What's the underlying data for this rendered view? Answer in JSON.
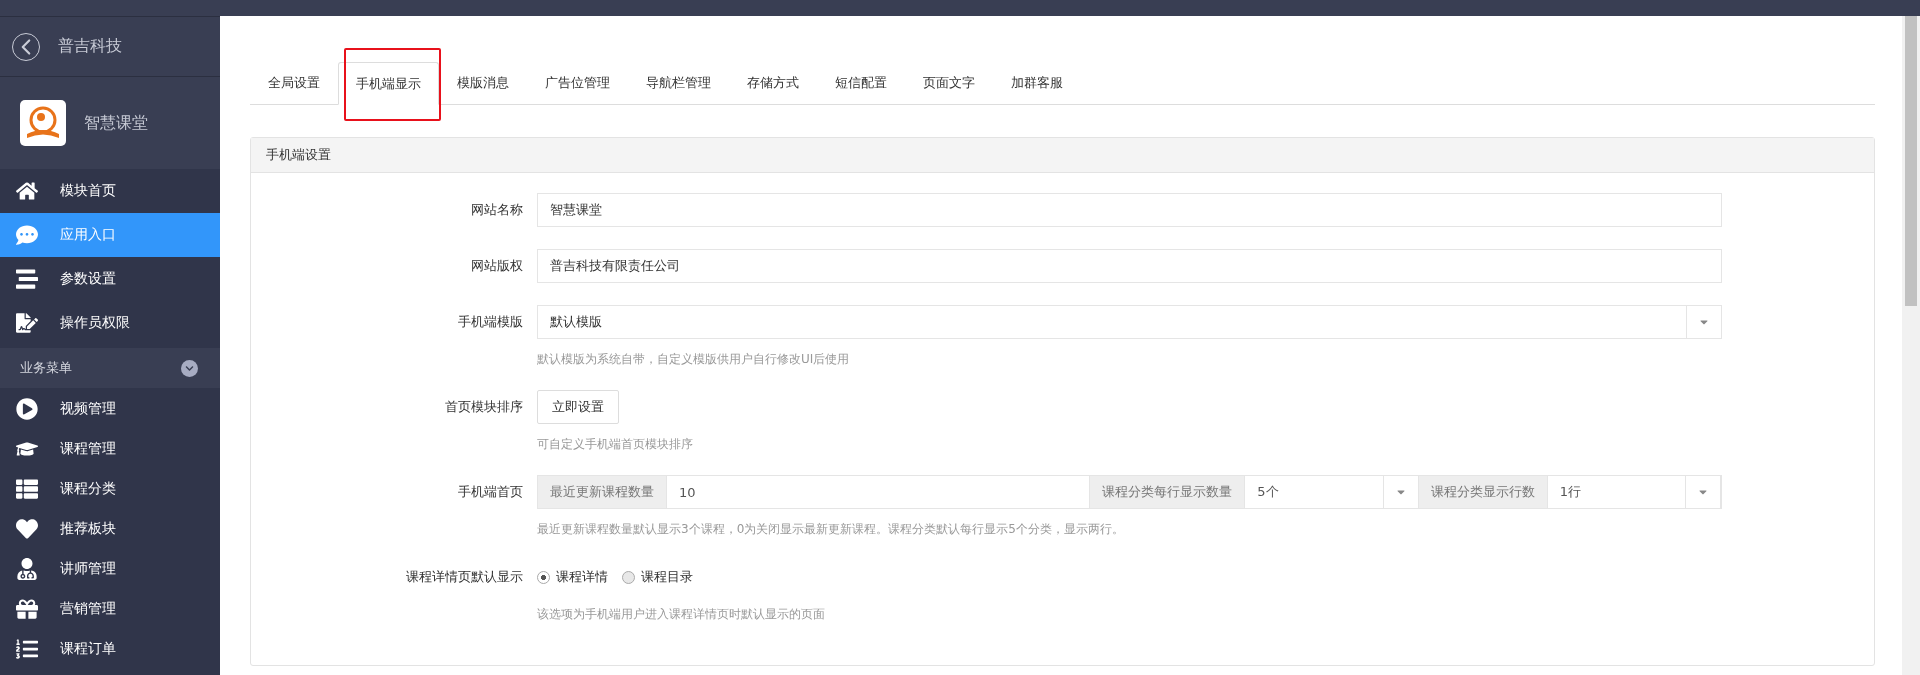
{
  "sidebar": {
    "back_label": "普吉科技",
    "app_name": "智慧课堂",
    "items": [
      {
        "label": "模块首页",
        "kind": "home",
        "selected": false
      },
      {
        "label": "应用入口",
        "kind": "chat",
        "selected": true
      },
      {
        "label": "参数设置",
        "kind": "sliders",
        "selected": false
      },
      {
        "label": "操作员权限",
        "kind": "doc",
        "selected": false
      }
    ],
    "group": {
      "label": "业务菜单",
      "expanded": true
    },
    "group_items": [
      {
        "label": "视频管理",
        "kind": "play",
        "selected": false
      },
      {
        "label": "课程管理",
        "kind": "cap",
        "selected": false
      },
      {
        "label": "课程分类",
        "kind": "list",
        "selected": false
      },
      {
        "label": "推荐板块",
        "kind": "heart",
        "selected": false
      },
      {
        "label": "讲师管理",
        "kind": "doctor",
        "selected": false
      },
      {
        "label": "营销管理",
        "kind": "gift",
        "selected": false
      },
      {
        "label": "课程订单",
        "kind": "numlist",
        "selected": false
      }
    ]
  },
  "tabs": [
    {
      "label": "全局设置",
      "selected": false
    },
    {
      "label": "手机端显示",
      "selected": true
    },
    {
      "label": "模版消息",
      "selected": false
    },
    {
      "label": "广告位管理",
      "selected": false
    },
    {
      "label": "导航栏管理",
      "selected": false
    },
    {
      "label": "存储方式",
      "selected": false
    },
    {
      "label": "短信配置",
      "selected": false
    },
    {
      "label": "页面文字",
      "selected": false
    },
    {
      "label": "加群客服",
      "selected": false
    }
  ],
  "panel": {
    "title": "手机端设置",
    "rows": [
      {
        "kind": "input",
        "label": "网站名称",
        "value": "智慧课堂"
      },
      {
        "kind": "input",
        "label": "网站版权",
        "value": "普吉科技有限责任公司"
      },
      {
        "kind": "select",
        "label": "手机端模版",
        "value": "默认模版",
        "help": "默认模版为系统自带，自定义模版供用户自行修改UI后使用"
      },
      {
        "kind": "button",
        "label": "首页模块排序",
        "button": "立即设置",
        "help": "可自定义手机端首页模块排序"
      },
      {
        "kind": "group",
        "label": "手机端首页",
        "parts": [
          {
            "kind": "addon",
            "text": "最近更新课程数量"
          },
          {
            "kind": "input",
            "value": "10"
          },
          {
            "kind": "addon",
            "text": "课程分类每行显示数量"
          },
          {
            "kind": "select",
            "value": "5个"
          },
          {
            "kind": "addon",
            "text": "课程分类显示行数"
          },
          {
            "kind": "select",
            "value": "1行"
          }
        ],
        "help": "最近更新课程数量默认显示3个课程，0为关闭显示最新更新课程。课程分类默认每行显示5个分类，显示两行。"
      },
      {
        "kind": "radio",
        "label": "课程详情页默认显示",
        "options": [
          {
            "label": "课程详情",
            "selected": true
          },
          {
            "label": "课程目录",
            "selected": false
          }
        ],
        "help": "该选项为手机端用户进入课程详情页时默认显示的页面"
      }
    ]
  }
}
